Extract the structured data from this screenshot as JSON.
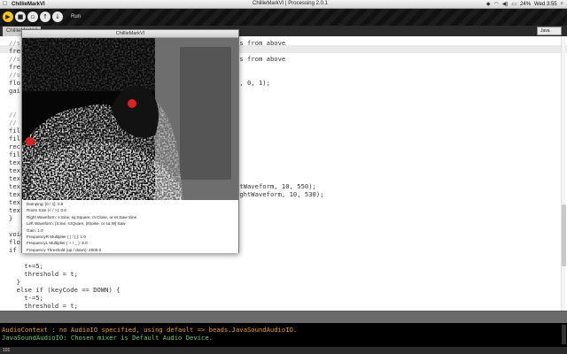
{
  "menubar": {
    "app_name": "ChillieMarkVI",
    "window_title": "ChillieMarkVI | Processing 2.0.1",
    "time": "Wed 3:55",
    "battery": "24%"
  },
  "toolbar": {
    "run_label": "Run",
    "buttons": [
      "run-icon",
      "stop-icon",
      "new-icon",
      "open-icon",
      "save-icon",
      "export-icon"
    ]
  },
  "tab": {
    "name": "ChillieMarkVI"
  },
  "mode": "Java",
  "editor_lines": [
    [
      "//s",
      "es from above"
    ],
    [
      "fre",
      ""
    ],
    [
      "//s",
      "es from above"
    ],
    [
      "fre",
      ""
    ],
    [
      "//s",
      ""
    ],
    [
      "flo",
      "), 0, 1);"
    ],
    [
      "gai",
      ""
    ],
    [
      "",
      ""
    ],
    [
      "",
      ""
    ],
    [
      "//",
      ""
    ],
    [
      "//",
      ""
    ],
    [
      "fil",
      ""
    ],
    [
      "fil",
      ""
    ],
    [
      "rec",
      ""
    ],
    [
      "fil",
      ""
    ],
    [
      "tex",
      ""
    ],
    [
      "tex",
      ""
    ],
    [
      "tex",
      ""
    ],
    [
      "tex",
      "ftWaveform, 10, 550);"
    ],
    [
      "tex",
      "ightWaveform, 10, 530);"
    ],
    [
      "tex",
      ""
    ],
    [
      "tex",
      ""
    ],
    [
      "}",
      ""
    ],
    [
      "",
      ""
    ],
    [
      "void ",
      ""
    ],
    [
      "flo",
      ""
    ],
    [
      "if (",
      ""
    ],
    [
      "",
      ""
    ],
    [
      "    t+=5;",
      ""
    ],
    [
      "    threshold = t;",
      ""
    ],
    [
      "  }",
      ""
    ],
    [
      "  else if (keyCode == DOWN) {",
      ""
    ],
    [
      "    t-=5;",
      ""
    ],
    [
      "    threshold = t;",
      ""
    ],
    [
      "  }",
      ""
    ]
  ],
  "console": {
    "lines": [
      "AudioContext : no AudioIO specified, using default => beads.JavaSoundAudioIO.",
      "JavaSoundAudioIO: Chosen mixer is Default Audio Device."
    ],
    "line_number": "101"
  },
  "sketch": {
    "title": "ChillieMarkVI",
    "params": [
      "Damping: [0 / 1]: 0.8",
      "Room Size (< / >): 0.6",
      "Right Waveform: s:Sine, sq:Square, m:Close, or ss:Saw Sine",
      "Left Waveform: [S:ine, s:tQuare, (N)oise, or sa:W] Saw",
      "Gain: 1.0",
      "FrequencyR Multiplier ( ) / [ ]: 1.0",
      "FrequencyL Multiplier ( + / _ ): 8.0",
      "Frequency Threshold (up / down): 2000.0"
    ]
  },
  "colors": {
    "tracker_dot": "#e02020",
    "keyword": "#cc6633",
    "run_button": "#f5c518"
  }
}
